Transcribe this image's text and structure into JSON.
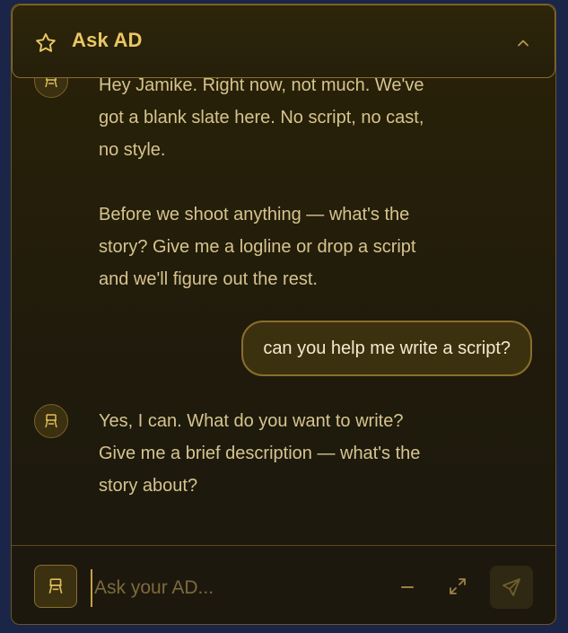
{
  "header": {
    "title": "Ask AD",
    "star_icon": "star-icon",
    "collapse_icon": "chevron-up-icon"
  },
  "messages": [
    {
      "role": "assistant",
      "lines": [
        "Hey Jamike. Right now, not much. We've",
        "got a blank slate here. No script, no cast,",
        "no style.",
        "",
        "Before we shoot anything — what's the",
        "story? Give me a logline or drop a script",
        "and we'll figure out the rest."
      ]
    },
    {
      "role": "user",
      "text": "can you help me write a script?"
    },
    {
      "role": "assistant",
      "lines": [
        "Yes, I can. What do you want to write?",
        "Give me a brief description — what's the",
        "story about?"
      ]
    }
  ],
  "input": {
    "placeholder": "Ask your AD...",
    "value": ""
  },
  "icons": {
    "avatar": "director-chair-icon",
    "minimize": "minus-icon",
    "expand": "expand-icon",
    "send": "send-icon"
  },
  "colors": {
    "accent": "#e9c765",
    "text": "#d6c48e",
    "panel_bg": "#221c0b",
    "border": "#8a6e2b",
    "page_bg": "#1b2547"
  }
}
